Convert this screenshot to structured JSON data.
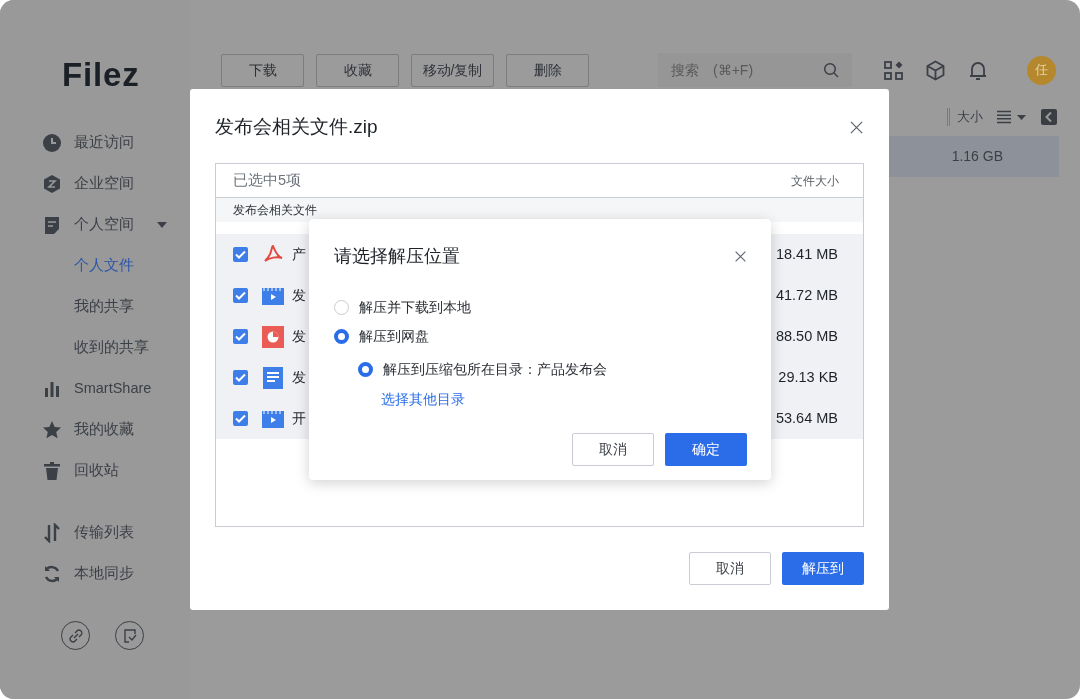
{
  "sidebar": {
    "logo": "Filez",
    "items": [
      {
        "label": "最近访问",
        "selected": false
      },
      {
        "label": "企业空间",
        "selected": false
      },
      {
        "label": "个人空间",
        "selected": false,
        "expanded": true,
        "children": [
          {
            "label": "个人文件",
            "selected": true
          },
          {
            "label": "我的共享",
            "selected": false
          },
          {
            "label": "收到的共享",
            "selected": false
          }
        ]
      },
      {
        "label": "SmartShare",
        "selected": false
      },
      {
        "label": "我的收藏",
        "selected": false
      },
      {
        "label": "回收站",
        "selected": false
      }
    ],
    "tools": [
      {
        "label": "传输列表"
      },
      {
        "label": "本地同步"
      }
    ]
  },
  "toolbar": {
    "buttons": [
      "下载",
      "收藏",
      "移动/复制",
      "删除"
    ],
    "search": {
      "placeholder": "搜索　(⌘+F)"
    },
    "avatar": "任"
  },
  "file_table": {
    "size_column": "大小",
    "rows": [
      {
        "size": "1.16 GB",
        "selected": true
      }
    ]
  },
  "archive_dialog": {
    "title": "发布会相关文件.zip",
    "selection": "已选中5项",
    "size_column": "文件大小",
    "folder": "发布会相关文件",
    "rows": [
      {
        "name": "产",
        "kind": "pdf",
        "size": "18.41 MB",
        "checked": true
      },
      {
        "name": "发",
        "kind": "video",
        "size": "41.72 MB",
        "checked": true
      },
      {
        "name": "发",
        "kind": "slides",
        "size": "88.50 MB",
        "checked": true
      },
      {
        "name": "发",
        "kind": "document",
        "size": "29.13 KB",
        "checked": true
      },
      {
        "name": "开",
        "kind": "video",
        "size": "53.64 MB",
        "checked": true
      }
    ],
    "buttons": [
      "取消",
      "解压到"
    ]
  },
  "location_dialog": {
    "title": "请选择解压位置",
    "options": [
      {
        "label": "解压并下载到本地",
        "selected": false
      },
      {
        "label": "解压到网盘",
        "selected": true,
        "children": [
          {
            "label": "解压到压缩包所在目录：产品发布会",
            "selected": true
          }
        ]
      }
    ],
    "link": "选择其他目录",
    "buttons": [
      "取消",
      "确定"
    ]
  }
}
